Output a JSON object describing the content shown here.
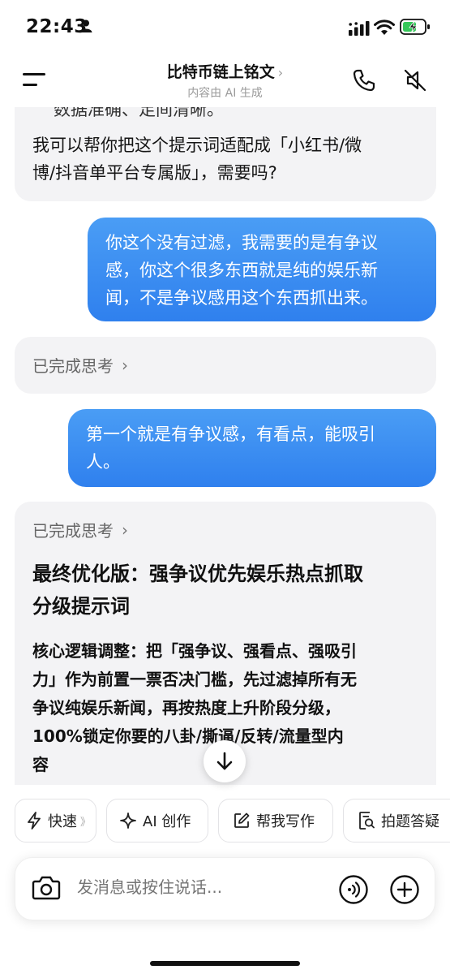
{
  "status_bar": {
    "time": "22:43"
  },
  "header": {
    "title": "比特币链上铭文",
    "chevron": "›",
    "subtitle": "内容由 AI 生成"
  },
  "chat": {
    "ai_msg_1": {
      "cut_line": "数据准确、足间清晰。",
      "lines": [
        "我可以帮你把这个提示词适配成「小红书/微",
        "博/抖音单平台专属版」，需要吗?"
      ]
    },
    "user_msg_1": {
      "lines": [
        "你这个没有过滤，我需要的是有争议",
        "感，你这个很多东西就是纯的娱乐新",
        "闻，不是争议感用这个东西抓出来。"
      ]
    },
    "think_1": {
      "label": "已完成思考",
      "chevron": "›"
    },
    "user_msg_2": {
      "lines": [
        "第一个就是有争议感，有看点，能吸引",
        "人。"
      ]
    },
    "ai_msg_2": {
      "think_label": "已完成思考",
      "think_chevron": "›",
      "heading_lines": [
        "最终优化版：强争议优先娱乐热点抓取",
        "分级提示词"
      ],
      "body_lines": [
        "核心逻辑调整：把「强争议、强看点、强吸引",
        "力」作为前置一票否决门槛，先过滤掉所有无",
        "争议纯娱乐新闻，再按热度上升阶段分级，",
        "100%锁定你要的八卦/撕逼/反转/流量型内",
        "容"
      ]
    }
  },
  "quick_actions": [
    {
      "label": "快速",
      "suffix": "》",
      "icon": "lightning-icon"
    },
    {
      "label": "AI 创作",
      "icon": "sparkle-icon"
    },
    {
      "label": "帮我写作",
      "icon": "edit-icon"
    },
    {
      "label": "拍题答疑",
      "icon": "scan-question-icon"
    }
  ],
  "input": {
    "placeholder": "发消息或按住说话..."
  },
  "colors": {
    "user_bubble": "#3a8bf2",
    "ai_bubble": "#f3f3f5",
    "background": "#ffffff"
  }
}
